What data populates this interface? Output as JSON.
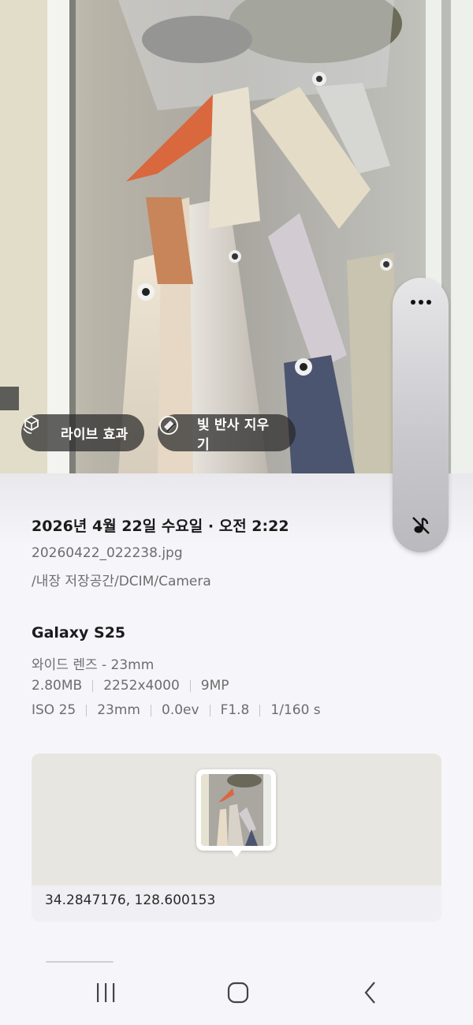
{
  "photo": {
    "chips": {
      "live_effect": "라이브 효과",
      "remove_reflection": "빛 반사 지우기"
    },
    "side_controls": {
      "more_icon": "more-horizontal-icon",
      "mute_icon": "mute-icon"
    }
  },
  "details": {
    "date": "2026년 4월 22일 수요일 · 오전 2:22",
    "filename": "20260422_022238.jpg",
    "path": "/내장 저장공간/DCIM/Camera",
    "device": "Galaxy S25",
    "lens": "와이드 렌즈 - 23mm",
    "specs_row1": [
      "2.80MB",
      "2252x4000",
      "9MP"
    ],
    "specs_row2": [
      "ISO 25",
      "23mm",
      "0.0ev",
      "F1.8",
      "1/160 s"
    ],
    "location": {
      "coordinates": "34.2847176, 128.600153"
    }
  },
  "navbar": {
    "recent_icon": "recent-apps-icon",
    "home_icon": "home-icon",
    "back_icon": "back-icon"
  },
  "colors": {
    "panel_bg": "#f6f5fa",
    "chip_bg": "#282828",
    "map_bg": "#e8e6e0"
  }
}
